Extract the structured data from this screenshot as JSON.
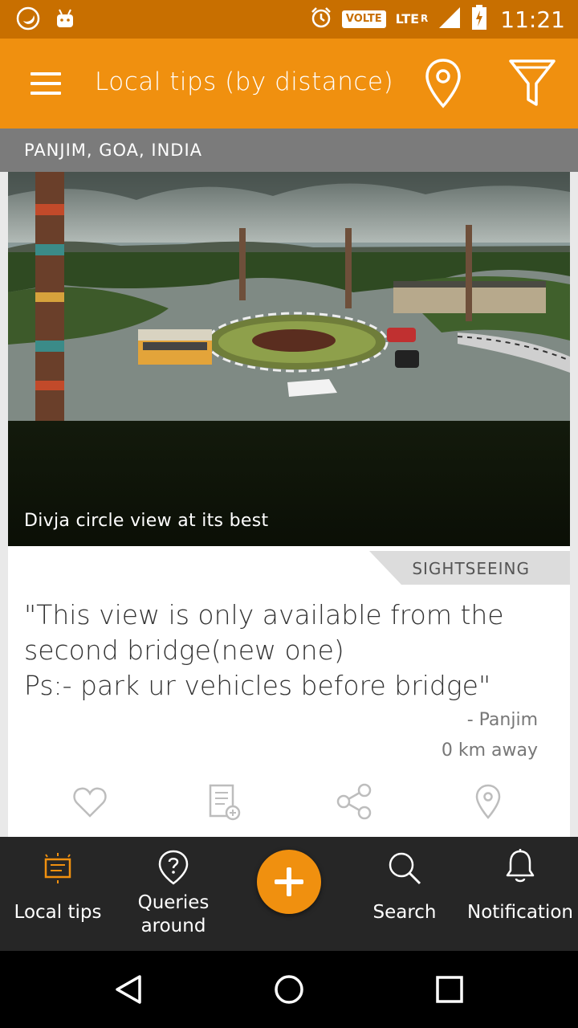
{
  "status_bar": {
    "time": "11:21",
    "network_badge": "VOLTE",
    "network_type": "LTE",
    "roaming": "R",
    "icons": [
      "moon-icon",
      "android-debug-icon",
      "alarm-icon",
      "signal-icon",
      "battery-charging-icon"
    ]
  },
  "app_bar": {
    "title": "Local tips (by distance)",
    "icons": [
      "menu-icon",
      "location-pin-icon",
      "filter-icon"
    ]
  },
  "location": {
    "label": "PANJIM, GOA, INDIA"
  },
  "tip_card": {
    "photo_caption": "Divja circle view at its best",
    "category": "SIGHTSEEING",
    "quote_lines": [
      "\"This view is only available from the",
      "second bridge(new one)",
      "Ps:- park ur vehicles before bridge\""
    ],
    "author": "- Panjim",
    "distance": "0 km away",
    "actions": [
      "heart-icon",
      "add-note-icon",
      "share-icon",
      "location-pin-icon"
    ]
  },
  "bottom_nav": {
    "items": [
      {
        "label": "Local tips",
        "icon": "tips-icon"
      },
      {
        "label_line1": "Queries",
        "label_line2": "around",
        "icon": "question-icon"
      },
      {
        "label": "Search",
        "icon": "search-icon"
      },
      {
        "label": "Notification",
        "icon": "bell-icon"
      }
    ],
    "fab_icon": "plus-icon"
  },
  "colors": {
    "accent": "#f0900f",
    "status_bar": "#c86f00",
    "location_strip": "#7b7b7b",
    "bottom_nav": "#262626"
  }
}
